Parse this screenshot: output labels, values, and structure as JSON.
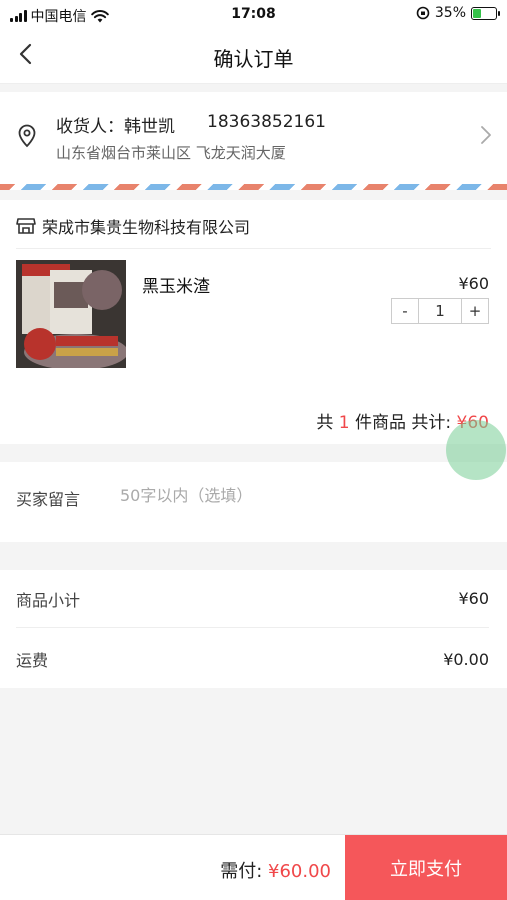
{
  "status_bar": {
    "carrier": "中国电信",
    "time": "17:08",
    "battery_percent": "35%",
    "battery_level": 0.35,
    "signal_icon": "signal-bars-icon",
    "wifi_icon": "wifi-icon",
    "lock_icon": "orientation-lock-icon"
  },
  "nav": {
    "title": "确认订单",
    "back_icon": "back-chevron-icon"
  },
  "address": {
    "receiver_label": "收货人：",
    "receiver_name": "韩世凯",
    "phone": "18363852161",
    "full_address": "山东省烟台市莱山区 飞龙天润大厦",
    "icon": "location-pin-icon",
    "chevron": "chevron-right-icon"
  },
  "shop": {
    "name": "荣成市集贵生物科技有限公司",
    "icon": "store-icon"
  },
  "product": {
    "name": "黑玉米渣",
    "price": "¥60",
    "quantity": "1",
    "minus_label": "-",
    "plus_label": "+"
  },
  "order_total": {
    "prefix": "共",
    "count": "1",
    "suffix": "件商品 共计:",
    "amount": "¥60"
  },
  "message": {
    "label": "买家留言",
    "placeholder": "50字以内（选填）"
  },
  "summary": {
    "subtotal_label": "商品小计",
    "subtotal_value": "¥60",
    "shipping_label": "运费",
    "shipping_value": "¥0.00"
  },
  "bottom_bar": {
    "pay_label": "需付:",
    "pay_amount": "¥60.00",
    "pay_button": "立即支付"
  },
  "colors": {
    "accent_red": "#f0484a",
    "button_red": "#f5575a",
    "page_bg": "#f4f4f4"
  }
}
